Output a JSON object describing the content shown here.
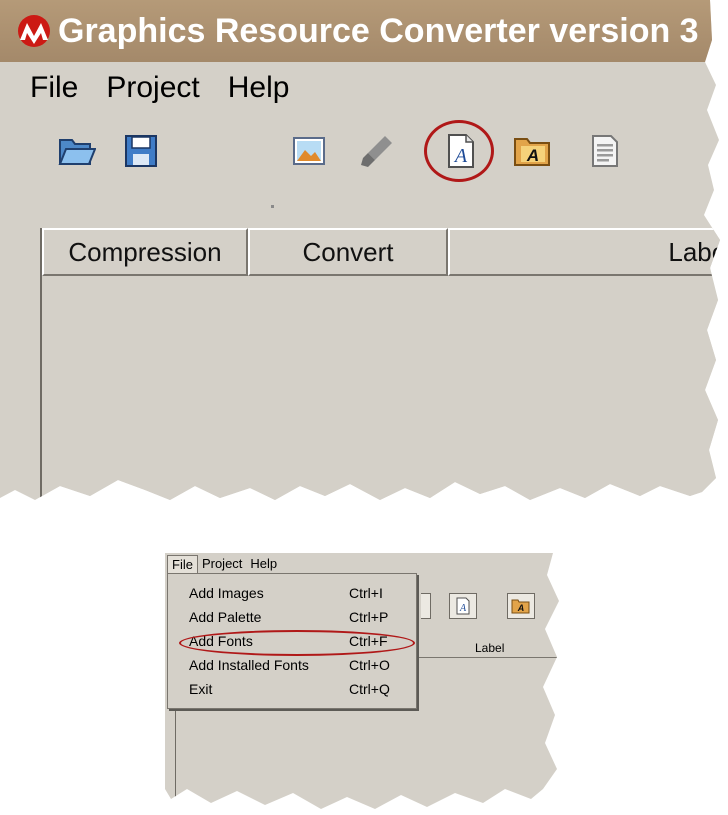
{
  "window": {
    "title": "Graphics Resource Converter version 3"
  },
  "menubar": {
    "items": [
      "File",
      "Project",
      "Help"
    ]
  },
  "toolbar": {
    "icons": [
      "open-folder-icon",
      "save-disk-icon",
      "add-image-icon",
      "palette-brush-icon",
      "add-font-icon",
      "installed-font-icon",
      "document-icon"
    ],
    "highlighted": "add-font-icon"
  },
  "table": {
    "columns": [
      "Compression",
      "Convert",
      "Label"
    ]
  },
  "file_menu": {
    "open_menu": "File",
    "items": [
      {
        "label": "Add Images",
        "shortcut": "Ctrl+I"
      },
      {
        "label": "Add Palette",
        "shortcut": "Ctrl+P"
      },
      {
        "label": "Add Fonts",
        "shortcut": "Ctrl+F"
      },
      {
        "label": "Add Installed Fonts",
        "shortcut": "Ctrl+O"
      },
      {
        "label": "Exit",
        "shortcut": "Ctrl+Q"
      }
    ],
    "highlighted_item": "Add Fonts"
  },
  "colors": {
    "window_bg": "#d4d0c8",
    "title_bar": "#a98f6f",
    "highlight_oval": "#b01818",
    "logo_red": "#cc1a14"
  }
}
